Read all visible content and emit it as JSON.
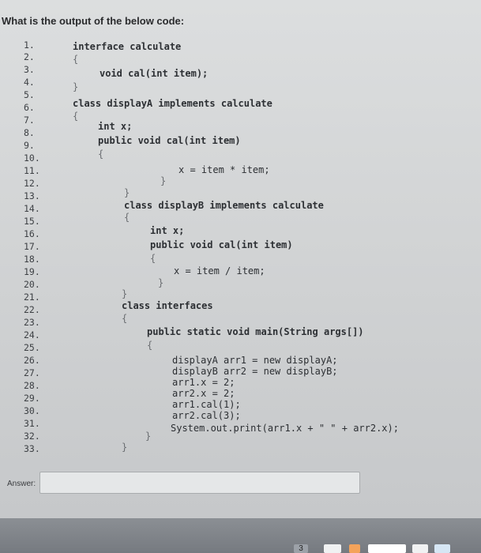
{
  "question": {
    "title": "What is the output of the below code:"
  },
  "code": {
    "line_numbers": [
      "1.",
      "2.",
      "3.",
      "4.",
      "5.",
      "6.",
      "7.",
      "8.",
      "9.",
      "10.",
      "11.",
      "12.",
      "13.",
      "14.",
      "15.",
      "16.",
      "17.",
      "18.",
      "19.",
      "20.",
      "21.",
      "22.",
      "23.",
      "24.",
      "25.",
      "26.",
      "27.",
      "28.",
      "29.",
      "30.",
      "31.",
      "32.",
      "33."
    ],
    "lines": [
      "interface calculate",
      "{",
      "void cal(int item);",
      "}",
      "class displayA implements calculate",
      "{",
      "int x;",
      "public void cal(int item)",
      "{",
      "x = item * item;",
      "}",
      "}",
      "class displayB implements calculate",
      "{",
      "int x;",
      "public void cal(int item)",
      "{",
      "x = item / item;",
      "}",
      "}",
      "class interfaces",
      "{",
      "public static void main(String args[])",
      "{",
      "displayA arr1 = new displayA;",
      "displayB arr2 = new displayB;",
      "arr1.x = 2;",
      "arr2.x = 2;",
      "arr1.cal(1);",
      "arr2.cal(3);",
      "System.out.print(arr1.x + \" \" + arr2.x);",
      "}",
      "}"
    ]
  },
  "answer": {
    "label": "Answer:",
    "value": ""
  },
  "taskbar": {
    "badge": "3"
  }
}
